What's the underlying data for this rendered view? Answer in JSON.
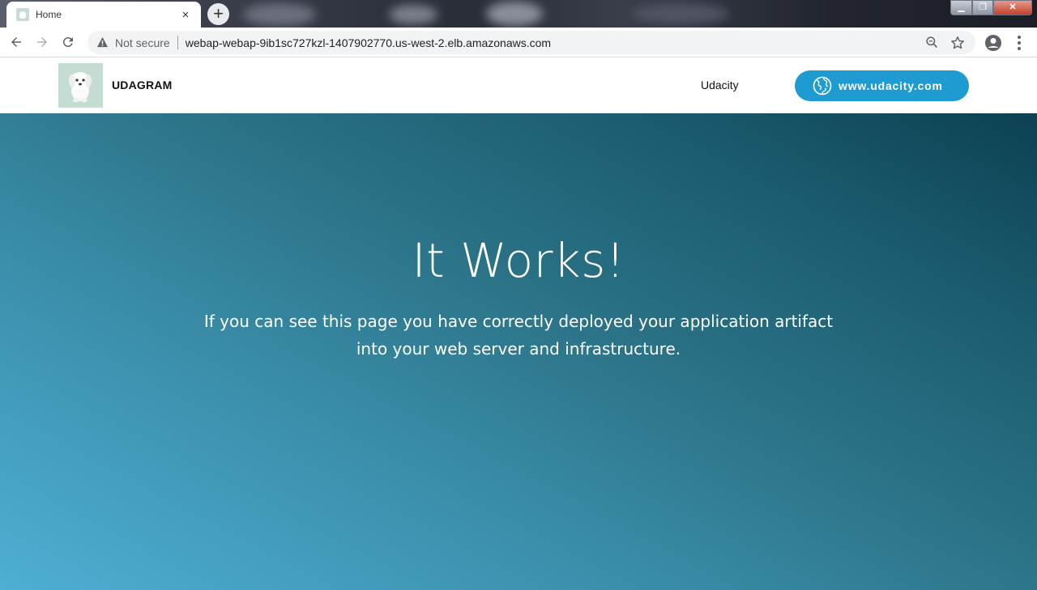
{
  "browser": {
    "tab_title": "Home",
    "tab_close": "×",
    "new_tab": "+",
    "security_label": "Not secure",
    "url": "webap-webap-9ib1sc727kzl-1407902770.us-west-2.elb.amazonaws.com",
    "window_buttons": {
      "minimize": "▁",
      "maximize": "❐",
      "close": "✕"
    }
  },
  "header": {
    "brand": "UDAGRAM",
    "nav_link": "Udacity",
    "cta_label": "www.udacity.com"
  },
  "hero": {
    "title": "It Works!",
    "text": "If you can see this page you have correctly deployed your application artifact into your web server and infrastructure."
  },
  "colors": {
    "cta": "#1e9bd0",
    "hero_light": "#4eafd4",
    "hero_dark": "#0c4152",
    "logo_bg": "#c3ddd3"
  },
  "icons": {
    "back": "back-arrow-icon",
    "forward": "forward-arrow-icon",
    "reload": "reload-icon",
    "warning": "warning-triangle-icon",
    "zoom": "zoom-icon",
    "bookmark": "star-icon",
    "account": "account-icon",
    "menu": "kebab-menu-icon",
    "globe": "globe-icon"
  }
}
